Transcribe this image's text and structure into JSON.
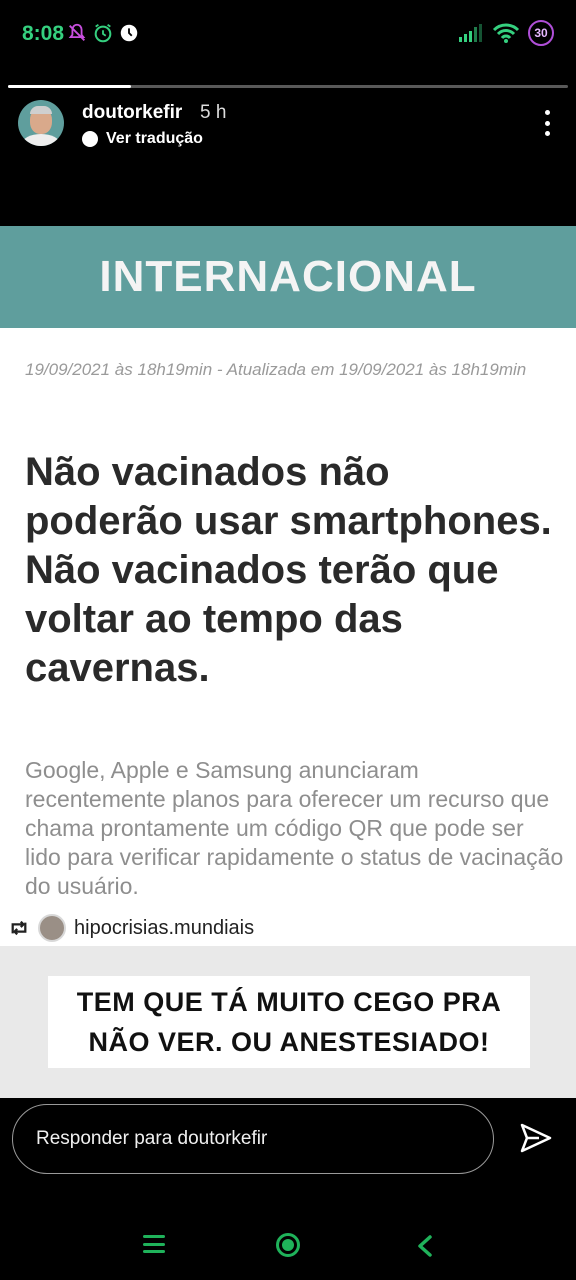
{
  "status_bar": {
    "time": "8:08",
    "icons": [
      "muted-bell-icon",
      "alarm-icon",
      "clock-icon",
      "signal-icon",
      "wifi-icon"
    ],
    "badge": "30",
    "accent_color": "#35d07f"
  },
  "story": {
    "username": "doutorkefir",
    "age": "5 h",
    "translate_label": "Ver tradução",
    "progress": 0.22,
    "banner": "INTERNACIONAL",
    "banner_color": "#5f9e9d",
    "article": {
      "date": "19/09/2021 às 18h19min - Atualizada em 19/09/2021 às 18h19min",
      "headline": "Não vacinados não poderão usar smartphones. Não vacinados terão que voltar ao tempo das cavernas.",
      "lead": "Google, Apple e Samsung anunciaram recentemente planos para oferecer um recurso que chama prontamente um código QR que pode ser lido para verificar rapidamente o status de vacinação do usuário."
    },
    "repost_account": "hipocrisias.mundiais",
    "caption_line1": "TEM QUE TÁ MUITO CEGO PRA",
    "caption_line2": "NÃO VER. OU ANESTESIADO!"
  },
  "reply": {
    "placeholder": "Responder para doutorkefir"
  },
  "nav": {
    "color": "#1fb25a"
  }
}
